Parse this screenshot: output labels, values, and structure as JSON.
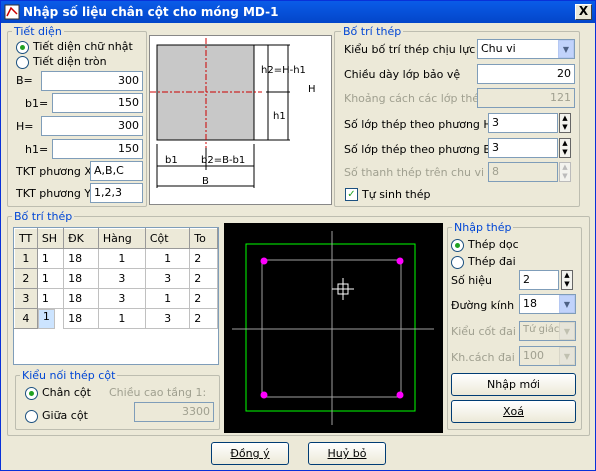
{
  "window": {
    "title": "Nhập số liệu chân cột cho móng MD-1",
    "close_label": "X"
  },
  "tiet_dien": {
    "legend": "Tiết diện",
    "radio_rect": "Tiết diện chữ nhật",
    "radio_round": "Tiết diện tròn",
    "selected": "rect",
    "B_label": "B=",
    "B_value": "300",
    "b1_label": "b1=",
    "b1_value": "150",
    "H_label": "H=",
    "H_value": "300",
    "h1_label": "h1=",
    "h1_value": "150",
    "tktx_label": "TKT phương X",
    "tktx_value": "A,B,C",
    "tkty_label": "TKT phương Y",
    "tkty_value": "1,2,3"
  },
  "diagram": {
    "h2_label": "h2=H-h1",
    "H_label": "H",
    "h1_label": "h1",
    "b1_label": "b1",
    "b2_label": "b2=B-b1",
    "B_label": "B"
  },
  "bo_tri_thep_top": {
    "legend": "Bố trí thép",
    "kieu_label": "Kiểu bố trí thép chịu lực",
    "kieu_value": "Chu vi",
    "chieu_day_label": "Chiều dày lớp bảo vệ",
    "chieu_day_value": "20",
    "khoang_cach_label": "Khoảng cách các lớp thép",
    "khoang_cach_value": "121",
    "so_lop_h_label": "Số lớp thép theo phương H",
    "so_lop_h_value": "3",
    "so_lop_b_label": "Số lớp thép theo phương B",
    "so_lop_b_value": "3",
    "so_thanh_label": "Số thanh thép trên chu vi cột",
    "so_thanh_value": "8",
    "tu_sinh_label": "Tự sinh thép",
    "tu_sinh_checked": true
  },
  "bo_tri_thep_table": {
    "legend": "Bố trí thép",
    "headers": [
      "TT",
      "SH",
      "ĐK",
      "Hàng",
      "Cột",
      "To"
    ],
    "rows": [
      [
        "1",
        "1",
        "18",
        "1",
        "1",
        "2"
      ],
      [
        "2",
        "1",
        "18",
        "3",
        "3",
        "2"
      ],
      [
        "3",
        "1",
        "18",
        "3",
        "1",
        "2"
      ],
      [
        "4",
        "1",
        "18",
        "1",
        "3",
        "2"
      ]
    ]
  },
  "kieu_noi": {
    "legend": "Kiểu nối thép cột",
    "chan_cot": "Chân cột",
    "giua_cot": "Giữa cột",
    "selected": "chan_cot",
    "chieu_cao_label": "Chiều cao tầng 1:",
    "chieu_cao_value": "3300"
  },
  "nhap_thep": {
    "legend": "Nhập thép",
    "thep_doc": "Thép dọc",
    "thep_dai": "Thép đai",
    "selected": "thep_doc",
    "so_hieu_label": "Số hiệu",
    "so_hieu_value": "2",
    "duong_kinh_label": "Đường kính",
    "duong_kinh_value": "18",
    "kieu_cot_dai_label": "Kiểu cốt đai",
    "kieu_cot_dai_value": "Tứ giác",
    "kh_cach_dai_label": "Kh.cách đai",
    "kh_cach_dai_value": "100",
    "nhap_moi": "Nhập mới",
    "xoa": "Xoá"
  },
  "footer": {
    "ok": "Đồng ý",
    "cancel": "Huỷ bỏ"
  },
  "colors": {
    "title_bar": "#0a5ce8",
    "legend_text": "#0046d5",
    "rebar": "#ff00ff",
    "outline": "#00ff00",
    "preview_bg": "#000000"
  }
}
